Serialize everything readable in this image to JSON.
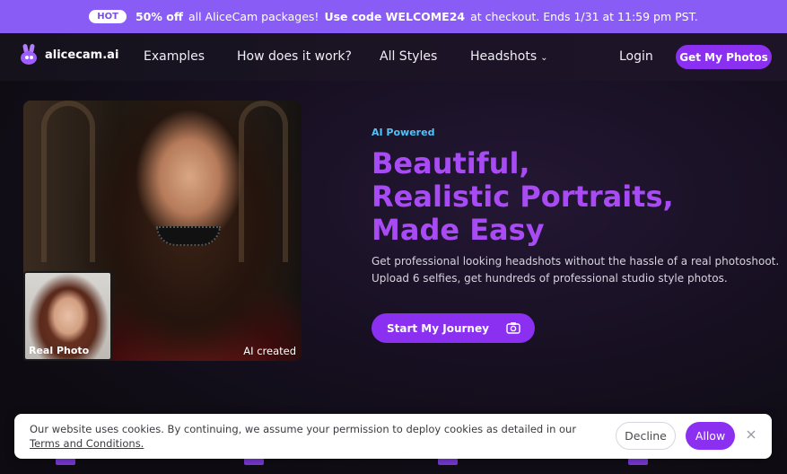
{
  "promo": {
    "badge": "HOT",
    "highlight": "50% off",
    "text1": "all AliceCam packages!",
    "code_text": "Use code WELCOME24",
    "text2": "at checkout. Ends 1/31 at 11:59 pm PST."
  },
  "nav": {
    "logo": "alicecam.ai",
    "links": [
      "Examples",
      "How does it work?",
      "All Styles",
      "Headshots"
    ],
    "login": "Login",
    "cta": "Get My Photos"
  },
  "hero": {
    "badge": "AI Powered",
    "headline": [
      "Beautiful,",
      "Realistic Portraits,",
      "Made Easy"
    ],
    "desc_line1": "Get professional looking headshots without the hassle of a real photoshoot.",
    "desc_line2": "Upload 6 selfies, get hundreds of professional studio style photos.",
    "cta": "Start My Journey",
    "real_label": "Real Photo",
    "ai_label": "AI created"
  },
  "cookie": {
    "message": "Our website uses cookies. By continuing, we assume your permission to deploy cookies as detailed in our",
    "link": "Terms and Conditions.",
    "decline": "Decline",
    "allow": "Allow"
  },
  "colors": {
    "accent": "#8b2ff0",
    "promo_bg": "#8a5cf6",
    "headline": "#a94bf5",
    "badge": "#4fc3f7"
  }
}
